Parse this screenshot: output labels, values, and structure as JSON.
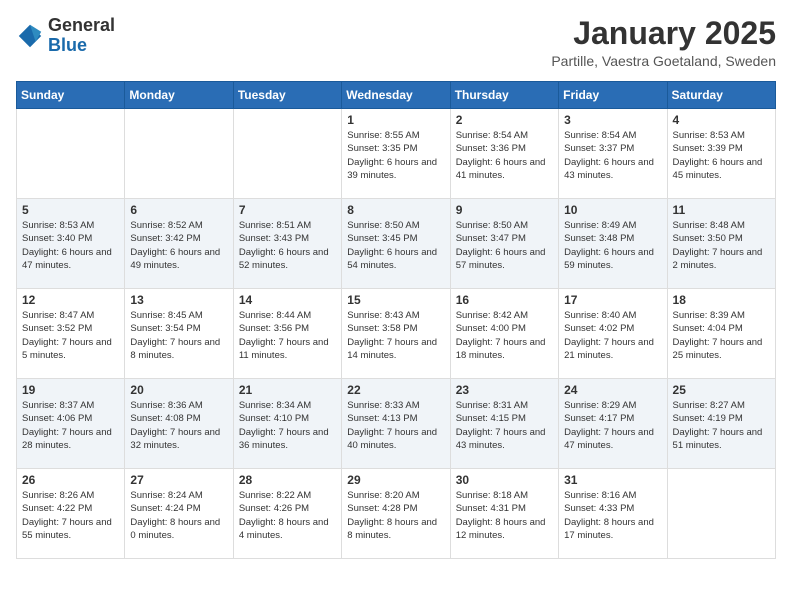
{
  "header": {
    "logo_general": "General",
    "logo_blue": "Blue",
    "month": "January 2025",
    "location": "Partille, Vaestra Goetaland, Sweden"
  },
  "weekdays": [
    "Sunday",
    "Monday",
    "Tuesday",
    "Wednesday",
    "Thursday",
    "Friday",
    "Saturday"
  ],
  "weeks": [
    [
      {
        "day": "",
        "info": ""
      },
      {
        "day": "",
        "info": ""
      },
      {
        "day": "",
        "info": ""
      },
      {
        "day": "1",
        "info": "Sunrise: 8:55 AM\nSunset: 3:35 PM\nDaylight: 6 hours\nand 39 minutes."
      },
      {
        "day": "2",
        "info": "Sunrise: 8:54 AM\nSunset: 3:36 PM\nDaylight: 6 hours\nand 41 minutes."
      },
      {
        "day": "3",
        "info": "Sunrise: 8:54 AM\nSunset: 3:37 PM\nDaylight: 6 hours\nand 43 minutes."
      },
      {
        "day": "4",
        "info": "Sunrise: 8:53 AM\nSunset: 3:39 PM\nDaylight: 6 hours\nand 45 minutes."
      }
    ],
    [
      {
        "day": "5",
        "info": "Sunrise: 8:53 AM\nSunset: 3:40 PM\nDaylight: 6 hours\nand 47 minutes."
      },
      {
        "day": "6",
        "info": "Sunrise: 8:52 AM\nSunset: 3:42 PM\nDaylight: 6 hours\nand 49 minutes."
      },
      {
        "day": "7",
        "info": "Sunrise: 8:51 AM\nSunset: 3:43 PM\nDaylight: 6 hours\nand 52 minutes."
      },
      {
        "day": "8",
        "info": "Sunrise: 8:50 AM\nSunset: 3:45 PM\nDaylight: 6 hours\nand 54 minutes."
      },
      {
        "day": "9",
        "info": "Sunrise: 8:50 AM\nSunset: 3:47 PM\nDaylight: 6 hours\nand 57 minutes."
      },
      {
        "day": "10",
        "info": "Sunrise: 8:49 AM\nSunset: 3:48 PM\nDaylight: 6 hours\nand 59 minutes."
      },
      {
        "day": "11",
        "info": "Sunrise: 8:48 AM\nSunset: 3:50 PM\nDaylight: 7 hours\nand 2 minutes."
      }
    ],
    [
      {
        "day": "12",
        "info": "Sunrise: 8:47 AM\nSunset: 3:52 PM\nDaylight: 7 hours\nand 5 minutes."
      },
      {
        "day": "13",
        "info": "Sunrise: 8:45 AM\nSunset: 3:54 PM\nDaylight: 7 hours\nand 8 minutes."
      },
      {
        "day": "14",
        "info": "Sunrise: 8:44 AM\nSunset: 3:56 PM\nDaylight: 7 hours\nand 11 minutes."
      },
      {
        "day": "15",
        "info": "Sunrise: 8:43 AM\nSunset: 3:58 PM\nDaylight: 7 hours\nand 14 minutes."
      },
      {
        "day": "16",
        "info": "Sunrise: 8:42 AM\nSunset: 4:00 PM\nDaylight: 7 hours\nand 18 minutes."
      },
      {
        "day": "17",
        "info": "Sunrise: 8:40 AM\nSunset: 4:02 PM\nDaylight: 7 hours\nand 21 minutes."
      },
      {
        "day": "18",
        "info": "Sunrise: 8:39 AM\nSunset: 4:04 PM\nDaylight: 7 hours\nand 25 minutes."
      }
    ],
    [
      {
        "day": "19",
        "info": "Sunrise: 8:37 AM\nSunset: 4:06 PM\nDaylight: 7 hours\nand 28 minutes."
      },
      {
        "day": "20",
        "info": "Sunrise: 8:36 AM\nSunset: 4:08 PM\nDaylight: 7 hours\nand 32 minutes."
      },
      {
        "day": "21",
        "info": "Sunrise: 8:34 AM\nSunset: 4:10 PM\nDaylight: 7 hours\nand 36 minutes."
      },
      {
        "day": "22",
        "info": "Sunrise: 8:33 AM\nSunset: 4:13 PM\nDaylight: 7 hours\nand 40 minutes."
      },
      {
        "day": "23",
        "info": "Sunrise: 8:31 AM\nSunset: 4:15 PM\nDaylight: 7 hours\nand 43 minutes."
      },
      {
        "day": "24",
        "info": "Sunrise: 8:29 AM\nSunset: 4:17 PM\nDaylight: 7 hours\nand 47 minutes."
      },
      {
        "day": "25",
        "info": "Sunrise: 8:27 AM\nSunset: 4:19 PM\nDaylight: 7 hours\nand 51 minutes."
      }
    ],
    [
      {
        "day": "26",
        "info": "Sunrise: 8:26 AM\nSunset: 4:22 PM\nDaylight: 7 hours\nand 55 minutes."
      },
      {
        "day": "27",
        "info": "Sunrise: 8:24 AM\nSunset: 4:24 PM\nDaylight: 8 hours\nand 0 minutes."
      },
      {
        "day": "28",
        "info": "Sunrise: 8:22 AM\nSunset: 4:26 PM\nDaylight: 8 hours\nand 4 minutes."
      },
      {
        "day": "29",
        "info": "Sunrise: 8:20 AM\nSunset: 4:28 PM\nDaylight: 8 hours\nand 8 minutes."
      },
      {
        "day": "30",
        "info": "Sunrise: 8:18 AM\nSunset: 4:31 PM\nDaylight: 8 hours\nand 12 minutes."
      },
      {
        "day": "31",
        "info": "Sunrise: 8:16 AM\nSunset: 4:33 PM\nDaylight: 8 hours\nand 17 minutes."
      },
      {
        "day": "",
        "info": ""
      }
    ]
  ]
}
